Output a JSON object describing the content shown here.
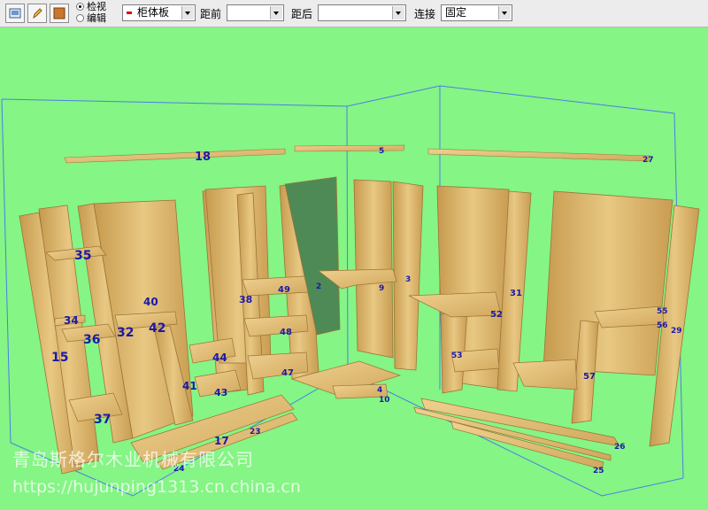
{
  "toolbar": {
    "buttons": [
      "view-icon",
      "pencil-icon",
      "panel-icon"
    ],
    "radio_view": "检视",
    "radio_edit": "编辑",
    "type_select": "柜体板",
    "front_label": "距前",
    "front_value": "",
    "back_label": "距后",
    "back_value": "",
    "connect_label": "连接",
    "connect_value": "固定"
  },
  "colors": {
    "background": "#85f585",
    "wood": "#e3c07a",
    "labels": "#1a1aa8",
    "guides": "#4a7fe8"
  },
  "labels": [
    "18",
    "5",
    "27",
    "35",
    "40",
    "34",
    "36",
    "32",
    "42",
    "15",
    "37",
    "41",
    "44",
    "43",
    "38",
    "49",
    "48",
    "47",
    "2",
    "3",
    "9",
    "4",
    "10",
    "31",
    "52",
    "53",
    "57",
    "55",
    "56",
    "17",
    "23",
    "24",
    "26",
    "25",
    "29"
  ],
  "watermark": {
    "line1": "青岛斯格尔木业机械有限公司",
    "line2": "https://hujunping1313.cn.china.cn"
  }
}
